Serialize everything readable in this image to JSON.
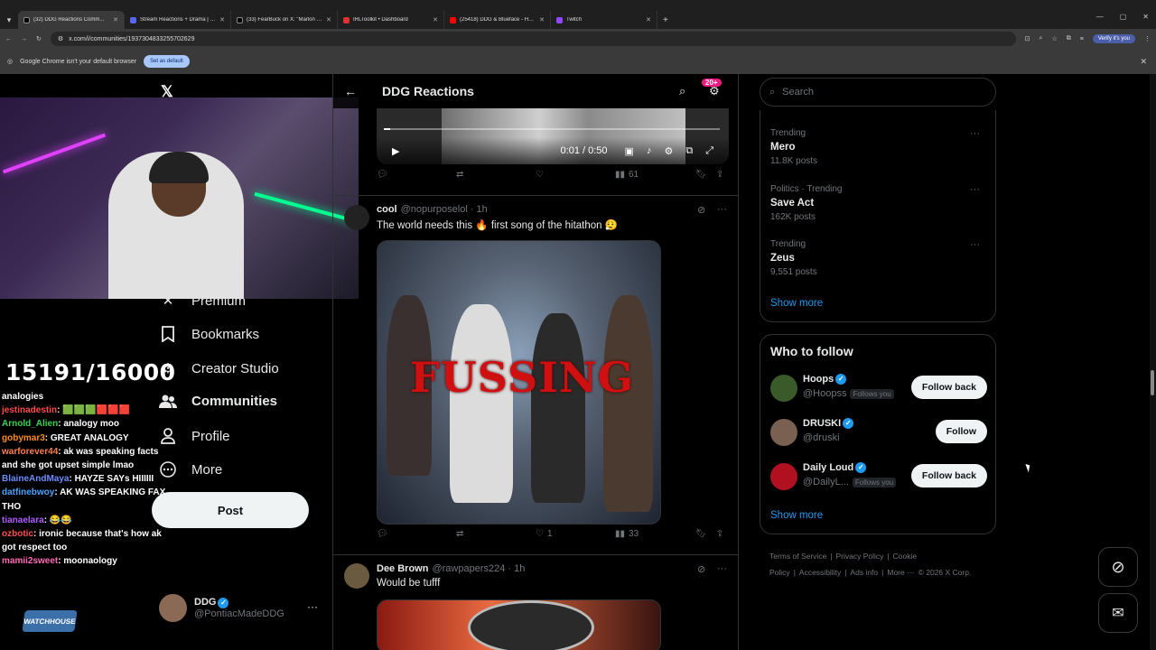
{
  "browser": {
    "tabs": [
      {
        "title": "(32) DDG Reactions Comm...",
        "color": "#e7e9ea",
        "active": true
      },
      {
        "title": "Stream Reactions + Drama | Ca...",
        "color": "#5865f2",
        "active": false
      },
      {
        "title": "(33) FearBuck on X: \"Marlon wa...",
        "color": "#e7e9ea",
        "active": false
      },
      {
        "title": "IRLToolkit • Dashboard",
        "color": "#e03030",
        "active": false
      },
      {
        "title": "(25418) DDG & Blueface - Hab...",
        "color": "#ff0000",
        "active": false
      },
      {
        "title": "Twitch",
        "color": "#9146ff",
        "active": false
      }
    ],
    "url": "x.com/i/communities/1937304833255702629",
    "verify_label": "Verify it's you",
    "infobar_text": "Google Chrome isn't your default browser",
    "infobar_button": "Set as default"
  },
  "overlay": {
    "counter": "15191/16000",
    "chat": [
      {
        "user": "",
        "text": "analogies",
        "color": "#fff"
      },
      {
        "user": "jestinadestin",
        "text": ": 🟩🟩🟩🟥🟥🟥",
        "color": "#ff4a4a"
      },
      {
        "user": "Arnold_Alien",
        "text": ": analogy moo",
        "color": "#39d353"
      },
      {
        "user": "gobymar3",
        "text": ": GREAT ANALOGY",
        "color": "#ff8c1a"
      },
      {
        "user": "warforever44",
        "text": ": ak was speaking facts and she got upset simple lmao",
        "color": "#ff7f50"
      },
      {
        "user": "BlaineAndMaya",
        "text": ": HAYZE SAYs HIIIIII",
        "color": "#6b8cff"
      },
      {
        "user": "datfinebwoy",
        "text": ": AK WAS SPEAKING FAX THO",
        "color": "#4aa3ff"
      },
      {
        "user": "tianaelara",
        "text": ": 😂😂",
        "color": "#b05cff"
      },
      {
        "user": "ozbotic",
        "text": ": ironic because that's how ak got respect too",
        "color": "#ff5050"
      },
      {
        "user": "mamii2sweet",
        "text": ": moonaology",
        "color": "#ff69b4"
      }
    ],
    "logo_text": "WATCHHOUSE"
  },
  "nav": {
    "logo": "𝕏",
    "items": [
      {
        "label": "Premium",
        "icon": "x-icon"
      },
      {
        "label": "Bookmarks",
        "icon": "bookmark-icon"
      },
      {
        "label": "Creator Studio",
        "icon": "creator-studio-icon"
      },
      {
        "label": "Communities",
        "icon": "communities-icon"
      },
      {
        "label": "Profile",
        "icon": "profile-icon"
      },
      {
        "label": "More",
        "icon": "more-icon"
      }
    ],
    "post_label": "Post",
    "account": {
      "name": "DDG",
      "handle": "@PontiacMadeDDG",
      "more": "···"
    }
  },
  "center": {
    "header_title": "DDG Reactions",
    "notif_badge": "20+",
    "video": {
      "time": "0:01 / 0:50",
      "progress": 0.02
    },
    "top_actions": {
      "replies": "",
      "reposts": "",
      "likes": "",
      "views": "61"
    },
    "tweets": [
      {
        "name": "cool",
        "handle": "@nopurposelol · 1h",
        "text": "The world needs this 🔥 first song of the hitathon 😮‍💨",
        "media_text": "FUSSING",
        "actions": {
          "replies": "",
          "reposts": "",
          "likes": "1",
          "views": "33"
        }
      },
      {
        "name": "Dee Brown",
        "handle": "@rawpapers224 · 1h",
        "text": "Would be tufff"
      }
    ]
  },
  "right": {
    "search_placeholder": "Search",
    "trends": [
      {
        "category": "Trending",
        "name": "Mero",
        "count": "11.8K posts"
      },
      {
        "category": "Politics · Trending",
        "name": "Save Act",
        "count": "162K posts"
      },
      {
        "category": "Trending",
        "name": "Zeus",
        "count": "9,551 posts"
      }
    ],
    "trends_show_more": "Show more",
    "wtf_title": "Who to follow",
    "wtf": [
      {
        "name": "Hoops",
        "handle": "@Hoopss",
        "follows_you": "Follows you",
        "button": "Follow back",
        "color": "#3a5a2a"
      },
      {
        "name": "DRUSKI",
        "handle": "@druski",
        "follows_you": "",
        "button": "Follow",
        "color": "#7a6050"
      },
      {
        "name": "Daily Loud",
        "handle": "@DailyL...",
        "follows_you": "Follows you",
        "button": "Follow back",
        "color": "#b01020"
      }
    ],
    "wtf_show_more": "Show more",
    "footer": [
      "Terms of Service",
      "|",
      "Privacy Policy",
      "|",
      "Cookie Policy",
      "|",
      "Accessibility",
      "|",
      "Ads info",
      "|",
      "More ···",
      "© 2026 X Corp."
    ]
  }
}
